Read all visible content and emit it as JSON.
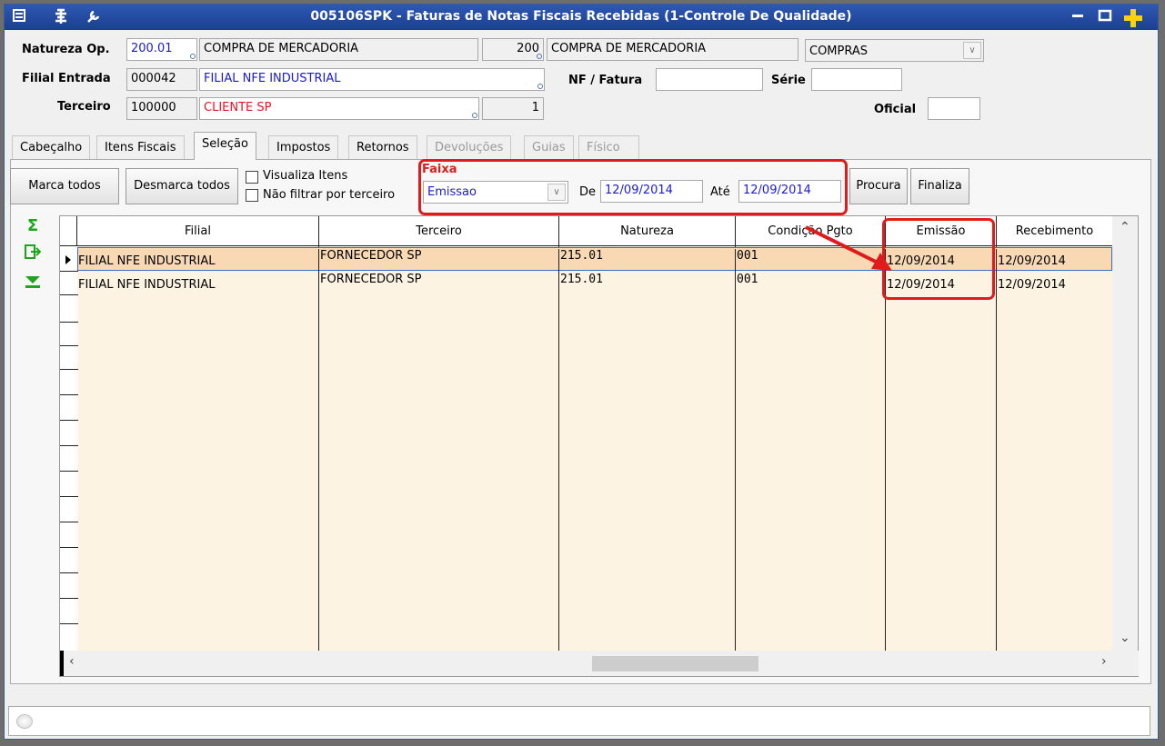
{
  "window": {
    "title": "005106SPK - Faturas de Notas Fiscais Recebidas (1-Controle De Qualidade)",
    "left_icons": [
      "menu-icon",
      "tools-icon",
      "wrench-icon"
    ],
    "right_icons": [
      "minimize-icon",
      "maximize-icon",
      "add-icon"
    ]
  },
  "header": {
    "natureza_label": "Natureza Op.",
    "natureza_code": "200.01",
    "natureza_desc": "COMPRA DE MERCADORIA",
    "natureza_code2": "200",
    "natureza_desc2": "COMPRA DE MERCADORIA",
    "tipo_value": "COMPRAS",
    "filial_label": "Filial Entrada",
    "filial_code": "000042",
    "filial_name": "FILIAL NFE INDUSTRIAL",
    "nf_label": "NF / Fatura",
    "nf_value": "",
    "serie_label": "Série",
    "serie_value": "",
    "terceiro_label": "Terceiro",
    "terceiro_code": "100000",
    "terceiro_name": "CLIENTE SP",
    "terceiro_seq": "1",
    "oficial_label": "Oficial",
    "oficial_value": ""
  },
  "tabs": [
    {
      "label": "Cabeçalho",
      "state": "normal"
    },
    {
      "label": "Itens Fiscais",
      "state": "normal"
    },
    {
      "label": "Seleção",
      "state": "active"
    },
    {
      "label": "Impostos",
      "state": "normal"
    },
    {
      "label": "Retornos",
      "state": "normal"
    },
    {
      "label": "Devoluções",
      "state": "disabled"
    },
    {
      "label": "Guias",
      "state": "disabled"
    },
    {
      "label": "Físico",
      "state": "disabled"
    }
  ],
  "toolbar": {
    "marca_todos": "Marca todos",
    "desmarca_todos": "Desmarca todos",
    "visualiza_itens": "Visualiza Itens",
    "nao_filtrar": "Não filtrar por terceiro",
    "faixa_label": "Faixa",
    "faixa_value": "Emissao",
    "de_label": "De",
    "de_value": "12/09/2014",
    "ate_label": "Até",
    "ate_value": "12/09/2014",
    "procura": "Procura",
    "finaliza": "Finaliza"
  },
  "side_icons": [
    "sum-icon",
    "export-icon",
    "filter-down-icon"
  ],
  "grid": {
    "columns": [
      "Filial",
      "Terceiro",
      "Natureza",
      "Condição Pgto",
      "Emissão",
      "Recebimento"
    ],
    "rows": [
      [
        "FILIAL NFE INDUSTRIAL",
        "FORNECEDOR SP",
        "215.01",
        "001",
        "12/09/2014",
        "12/09/2014"
      ],
      [
        "FILIAL NFE INDUSTRIAL",
        "FORNECEDOR SP",
        "215.01",
        "001",
        "12/09/2014",
        "12/09/2014"
      ]
    ]
  },
  "colors": {
    "title_bar": "#2d58b4",
    "highlight": "#e01b1b",
    "grid_row_bg": "#fdf3e3",
    "field_blue": "#1a1ad8",
    "field_red": "#e8141e"
  }
}
